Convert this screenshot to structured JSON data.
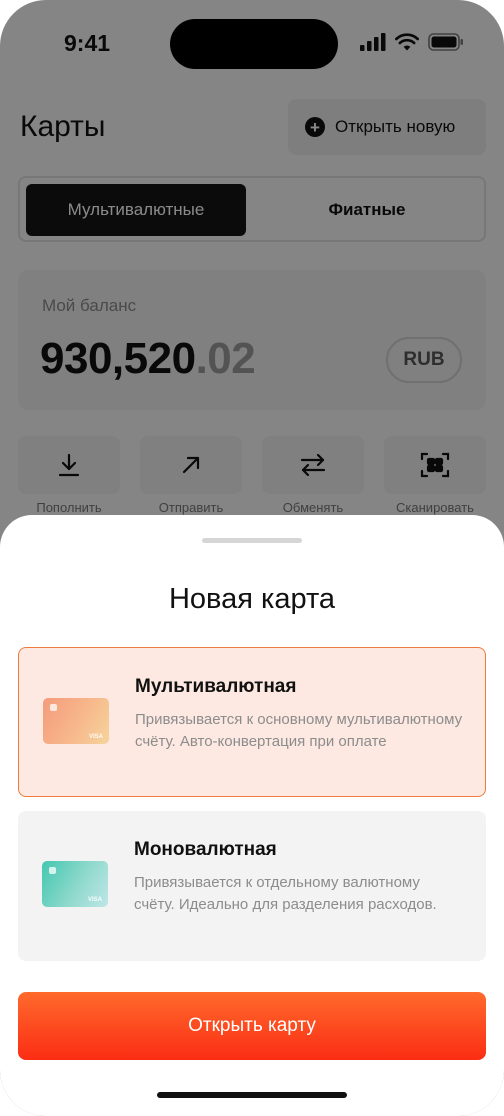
{
  "status_bar": {
    "time": "9:41"
  },
  "header": {
    "title": "Карты",
    "open_new_label": "Открыть новую"
  },
  "segmented": {
    "active": "Мультивалютные",
    "inactive": "Фиатные"
  },
  "balance": {
    "label": "Мой баланс",
    "amount_main": "930,520",
    "amount_cents": ".02",
    "currency": "RUB"
  },
  "actions": [
    {
      "label": "Пополнить",
      "icon": "download-icon"
    },
    {
      "label": "Отправить",
      "icon": "arrow-up-right-icon"
    },
    {
      "label": "Обменять",
      "icon": "swap-icon"
    },
    {
      "label": "Сканировать",
      "icon": "scan-icon"
    }
  ],
  "sheet": {
    "title": "Новая карта",
    "options": [
      {
        "title": "Мультивалютная",
        "description": "Привязывается к основному мультивалютному счёту. Авто-конвертация при оплате",
        "selected": true,
        "card_brand": "VISA"
      },
      {
        "title": "Моновалютная",
        "description": "Привязывается к отдельному валютному счёту. Идеально для разделения расходов.",
        "selected": false,
        "card_brand": "VISA"
      }
    ],
    "cta_label": "Открыть карту"
  },
  "colors": {
    "accent": "#fb3a1c",
    "selected_bg": "#fde9e2",
    "selected_border": "#ee7b3e"
  }
}
